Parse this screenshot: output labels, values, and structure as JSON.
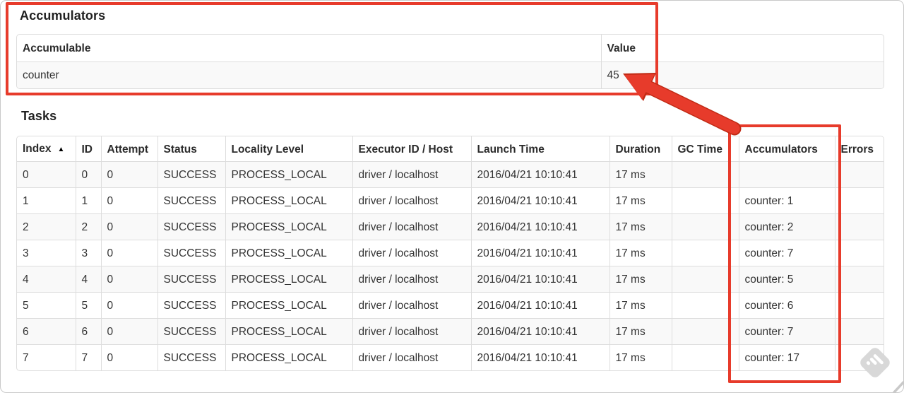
{
  "accumulators_section": {
    "heading": "Accumulators",
    "table": {
      "columns": [
        "Accumulable",
        "Value"
      ],
      "rows": [
        {
          "accumulable": "counter",
          "value": "45"
        }
      ]
    }
  },
  "tasks_section": {
    "heading": "Tasks",
    "table": {
      "columns": [
        {
          "label": "Index",
          "sort": "▲"
        },
        {
          "label": "ID"
        },
        {
          "label": "Attempt"
        },
        {
          "label": "Status"
        },
        {
          "label": "Locality Level"
        },
        {
          "label": "Executor ID / Host"
        },
        {
          "label": "Launch Time"
        },
        {
          "label": "Duration"
        },
        {
          "label": "GC Time"
        },
        {
          "label": "Accumulators"
        },
        {
          "label": "Errors"
        }
      ],
      "rows": [
        {
          "index": "0",
          "id": "0",
          "attempt": "0",
          "status": "SUCCESS",
          "locality_level": "PROCESS_LOCAL",
          "executor": "driver / localhost",
          "launch_time": "2016/04/21 10:10:41",
          "duration": "17 ms",
          "gc_time": "",
          "accumulators": "",
          "errors": ""
        },
        {
          "index": "1",
          "id": "1",
          "attempt": "0",
          "status": "SUCCESS",
          "locality_level": "PROCESS_LOCAL",
          "executor": "driver / localhost",
          "launch_time": "2016/04/21 10:10:41",
          "duration": "17 ms",
          "gc_time": "",
          "accumulators": "counter: 1",
          "errors": ""
        },
        {
          "index": "2",
          "id": "2",
          "attempt": "0",
          "status": "SUCCESS",
          "locality_level": "PROCESS_LOCAL",
          "executor": "driver / localhost",
          "launch_time": "2016/04/21 10:10:41",
          "duration": "17 ms",
          "gc_time": "",
          "accumulators": "counter: 2",
          "errors": ""
        },
        {
          "index": "3",
          "id": "3",
          "attempt": "0",
          "status": "SUCCESS",
          "locality_level": "PROCESS_LOCAL",
          "executor": "driver / localhost",
          "launch_time": "2016/04/21 10:10:41",
          "duration": "17 ms",
          "gc_time": "",
          "accumulators": "counter: 7",
          "errors": ""
        },
        {
          "index": "4",
          "id": "4",
          "attempt": "0",
          "status": "SUCCESS",
          "locality_level": "PROCESS_LOCAL",
          "executor": "driver / localhost",
          "launch_time": "2016/04/21 10:10:41",
          "duration": "17 ms",
          "gc_time": "",
          "accumulators": "counter: 5",
          "errors": ""
        },
        {
          "index": "5",
          "id": "5",
          "attempt": "0",
          "status": "SUCCESS",
          "locality_level": "PROCESS_LOCAL",
          "executor": "driver / localhost",
          "launch_time": "2016/04/21 10:10:41",
          "duration": "17 ms",
          "gc_time": "",
          "accumulators": "counter: 6",
          "errors": ""
        },
        {
          "index": "6",
          "id": "6",
          "attempt": "0",
          "status": "SUCCESS",
          "locality_level": "PROCESS_LOCAL",
          "executor": "driver / localhost",
          "launch_time": "2016/04/21 10:10:41",
          "duration": "17 ms",
          "gc_time": "",
          "accumulators": "counter: 7",
          "errors": ""
        },
        {
          "index": "7",
          "id": "7",
          "attempt": "0",
          "status": "SUCCESS",
          "locality_level": "PROCESS_LOCAL",
          "executor": "driver / localhost",
          "launch_time": "2016/04/21 10:10:41",
          "duration": "17 ms",
          "gc_time": "",
          "accumulators": "counter: 17",
          "errors": ""
        }
      ]
    }
  },
  "annotations": {
    "accent_color": "#e73b2b",
    "arrow_outline_color": "#c02a14"
  }
}
